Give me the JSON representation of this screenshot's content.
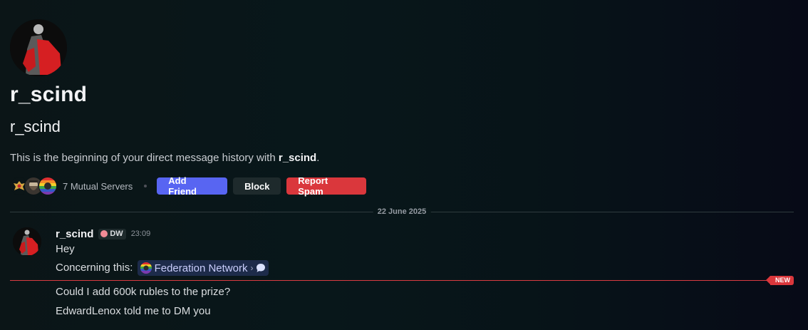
{
  "profile": {
    "display_name": "r_scind",
    "username": "r_scind",
    "intro_prefix": "This is the beginning of your direct message history with ",
    "intro_name": "r_scind",
    "intro_suffix": "."
  },
  "actions": {
    "mutual_servers": "7 Mutual Servers",
    "add_friend": "Add Friend",
    "block": "Block",
    "report_spam": "Report Spam"
  },
  "divider": {
    "date": "22 June 2025"
  },
  "message": {
    "author": "r_scind",
    "tag": "DW",
    "timestamp": "23:09",
    "lines": {
      "hey": "Hey",
      "concerning": "Concerning this:",
      "chip_server": "Federation Network",
      "add_rubles": "Could I add 600k rubles to the prize?",
      "edward": "EdwardLenox told me to DM you"
    },
    "new_label": "NEW"
  },
  "colors": {
    "accent": "#5865f2",
    "danger": "#da373c",
    "secondary": "#1e2a2c"
  },
  "icons": {
    "avatar": "red-cloak-figure-avatar",
    "server_1": "eagle-emblem-icon",
    "server_2": "bearded-man-icon",
    "server_3": "rainbow-crest-icon",
    "chip_server_icon": "federation-network-icon",
    "chip_channel_icon": "speech-bubble-icon",
    "tag_icon": "pig-face-icon"
  }
}
